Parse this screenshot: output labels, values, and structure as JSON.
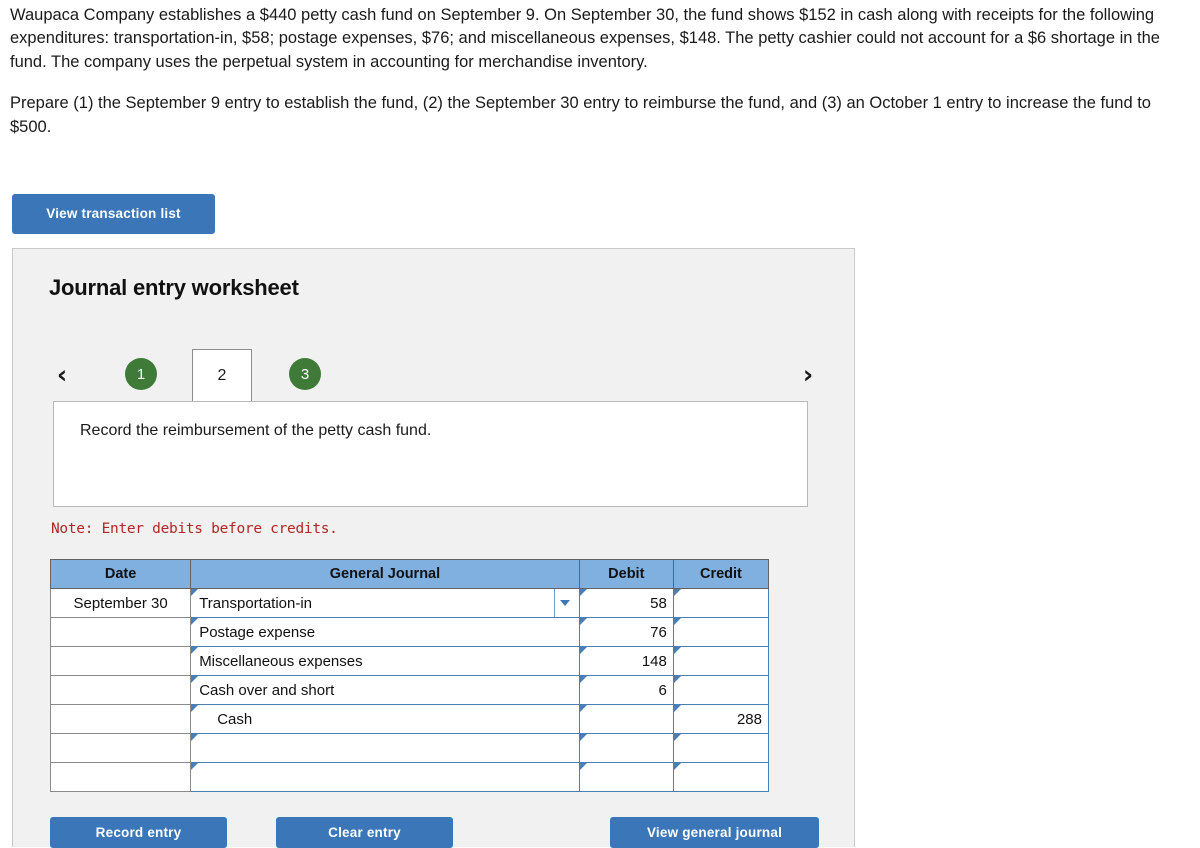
{
  "problem": {
    "paragraph_1": "Waupaca Company establishes a $440 petty cash fund on September 9. On September 30, the fund shows $152 in cash along with receipts for the following expenditures: transportation-in, $58; postage expenses, $76; and miscellaneous expenses, $148. The petty cashier could not account for a $6 shortage in the fund. The company uses the perpetual system in accounting for merchandise inventory.",
    "paragraph_2": "Prepare (1) the September 9 entry to establish the fund, (2) the September 30 entry to reimburse the fund, and (3) an October 1 entry to increase the fund to $500."
  },
  "toolbar": {
    "view_transaction_list_label": "View transaction list"
  },
  "worksheet": {
    "title": "Journal entry worksheet",
    "nav": {
      "prev_icon": "‹",
      "next_icon": "›"
    },
    "tabs": [
      {
        "label": "1",
        "state": "completed"
      },
      {
        "label": "2",
        "state": "active"
      },
      {
        "label": "3",
        "state": "completed"
      }
    ],
    "instruction": "Record the reimbursement of the petty cash fund.",
    "note": "Note: Enter debits before credits.",
    "colors": {
      "tab_complete": "#3f7a39",
      "header_blue": "#7fb0e0",
      "button_blue": "#3a76b8",
      "note_red": "#b02725",
      "cell_border_blue": "#4a7fb5"
    },
    "table": {
      "columns": [
        "Date",
        "General Journal",
        "Debit",
        "Credit"
      ],
      "rows": [
        {
          "date": "September 30",
          "account": "Transportation-in",
          "indent": false,
          "debit": "58",
          "credit": "",
          "has_dropdown": true
        },
        {
          "date": "",
          "account": "Postage expense",
          "indent": false,
          "debit": "76",
          "credit": "",
          "has_dropdown": false
        },
        {
          "date": "",
          "account": "Miscellaneous expenses",
          "indent": false,
          "debit": "148",
          "credit": "",
          "has_dropdown": false
        },
        {
          "date": "",
          "account": "Cash over and short",
          "indent": false,
          "debit": "6",
          "credit": "",
          "has_dropdown": false
        },
        {
          "date": "",
          "account": "Cash",
          "indent": true,
          "debit": "",
          "credit": "288",
          "has_dropdown": false
        },
        {
          "date": "",
          "account": "",
          "indent": false,
          "debit": "",
          "credit": "",
          "has_dropdown": false
        },
        {
          "date": "",
          "account": "",
          "indent": false,
          "debit": "",
          "credit": "",
          "has_dropdown": false
        }
      ]
    },
    "actions": {
      "record_entry_label": "Record entry",
      "clear_entry_label": "Clear entry",
      "view_general_journal_label": "View general journal"
    }
  }
}
